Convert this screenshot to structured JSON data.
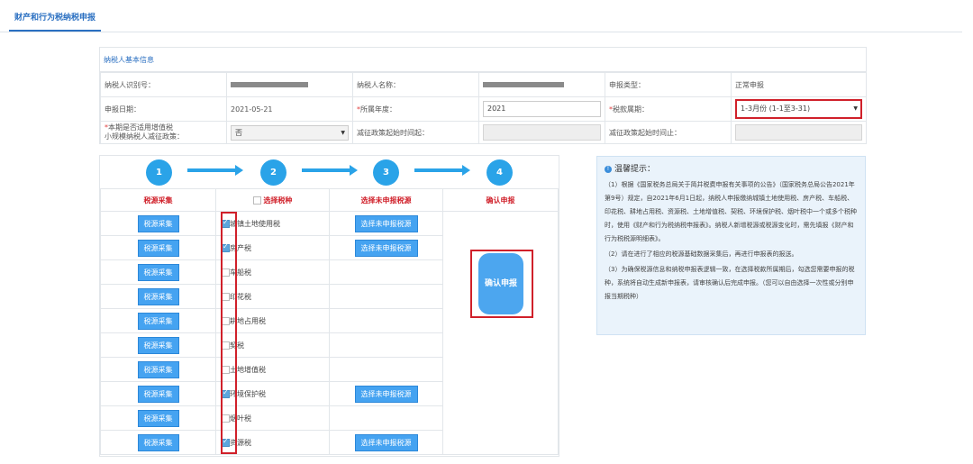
{
  "tab": {
    "label": "财产和行为税纳税申报"
  },
  "basic_info": {
    "header": "纳税人基本信息",
    "taxpayer_id_label": "纳税人识别号：",
    "taxpayer_name_label": "纳税人名称：",
    "declare_type_label": "申报类型：",
    "declare_type_value": "正常申报",
    "declare_date_label": "申报日期：",
    "declare_date_value": "2021-05-21",
    "year_label": "所属年度：",
    "year_value": "2021",
    "period_label": "税款属期：",
    "period_value": "1-3月份 (1-1至3-31)",
    "small_scale_label_1": "本期是否适用增值税",
    "small_scale_label_2": "小规模纳税人减征政策：",
    "small_scale_value": "否",
    "policy_start_label": "减征政策起始时间起：",
    "policy_end_label": "减征政策起始时间止："
  },
  "steps": [
    "1",
    "2",
    "3",
    "4"
  ],
  "columns": {
    "collect": "税源采集",
    "choose_tax": "选择税种",
    "choose_unreported": "选择未申报税源",
    "confirm": "确认申报"
  },
  "rows": [
    {
      "collect": "税源采集",
      "tax": "城镇土地使用税",
      "checked": true,
      "unreported": "选择未申报税源"
    },
    {
      "collect": "税源采集",
      "tax": "房产税",
      "checked": true,
      "unreported": "选择未申报税源"
    },
    {
      "collect": "税源采集",
      "tax": "车船税",
      "checked": false,
      "unreported": ""
    },
    {
      "collect": "税源采集",
      "tax": "印花税",
      "checked": false,
      "unreported": ""
    },
    {
      "collect": "税源采集",
      "tax": "耕地占用税",
      "checked": false,
      "unreported": ""
    },
    {
      "collect": "税源采集",
      "tax": "契税",
      "checked": false,
      "unreported": ""
    },
    {
      "collect": "税源采集",
      "tax": "土地增值税",
      "checked": false,
      "unreported": ""
    },
    {
      "collect": "税源采集",
      "tax": "环境保护税",
      "checked": true,
      "unreported": "选择未申报税源"
    },
    {
      "collect": "税源采集",
      "tax": "烟叶税",
      "checked": false,
      "unreported": ""
    },
    {
      "collect": "税源采集",
      "tax": "资源税",
      "checked": true,
      "unreported": "选择未申报税源"
    }
  ],
  "confirm_button": "确认申报",
  "tips": {
    "title": "温馨提示：",
    "p1": "（1）根据《国家税务总局关于简并税费申报有关事项的公告》（国家税务总局公告2021年第9号）规定，自2021年6月1日起，纳税人申报缴纳城镇土地使用税、房产税、车船税、印花税、耕地占用税、资源税、土地增值税、契税、环境保护税、烟叶税中一个或多个税种时，使用《财产和行为税纳税申报表》。纳税人新增税源或税源变化时，需先填报《财产和行为税税源明细表》。",
    "p2": "（2）请在进行了相应的税源基础数据采集后，再进行申报表的报送。",
    "p3": "（3）为确保税源信息和纳税申报表逻辑一致，在选择税款所属期后，勾选您需要申报的税种，系统将自动生成新申报表，请审核确认后完成申报。（您可以自由选择一次性或分别申报当期税种）"
  },
  "colors": {
    "accent": "#2a6fc1",
    "step": "#2aa3e8",
    "highlight": "#d0202a",
    "button": "#45a3f1"
  }
}
